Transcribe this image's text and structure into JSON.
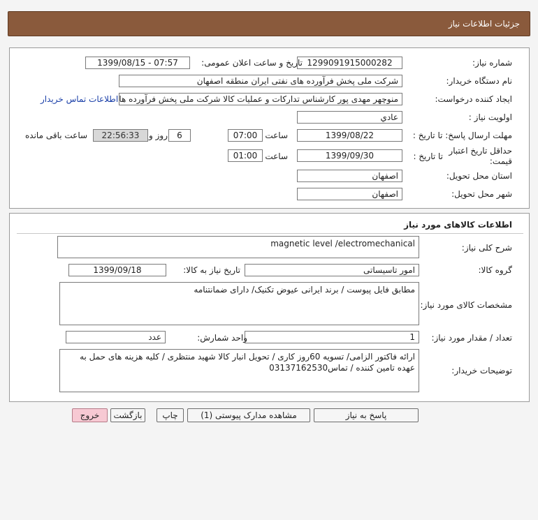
{
  "header": {
    "title": "جزئیات اطلاعات نیاز"
  },
  "info": {
    "need_number_label": "شماره نیاز:",
    "need_number": "1299091915000282",
    "announce_label": "تاریخ و ساعت اعلان عمومی:",
    "announce_value": "1399/08/15 - 07:57",
    "buyer_org_label": "نام دستگاه خریدار:",
    "buyer_org": "شرکت ملی پخش فرآورده های نفتی ایران منطقه اصفهان",
    "requester_label": "ایجاد کننده درخواست:",
    "requester": "منوچهر مهدی پور کارشناس تدارکات و عملیات کالا شرکت ملی پخش فرآورده های",
    "contact_link": "اطلاعات تماس خریدار",
    "priority_label": "اولویت نیاز :",
    "priority": "عادي",
    "deadline_label": "مهلت ارسال پاسخ: تا تاریخ :",
    "deadline_date": "1399/08/22",
    "time_label": "ساعت",
    "deadline_time": "07:00",
    "days": "6",
    "days_label": "روز و",
    "remaining_time": "22:56:33",
    "remaining_label": "ساعت باقی مانده",
    "validity_label_1": "حداقل تاریخ اعتبار",
    "validity_label_2": "قیمت:",
    "validity_to_label": "تا تاریخ :",
    "validity_date": "1399/09/30",
    "validity_time_label": "ساعت",
    "validity_time": "01:00",
    "province_label": "استان محل تحویل:",
    "province": "اصفهان",
    "city_label": "شهر محل تحویل:",
    "city": "اصفهان"
  },
  "goods": {
    "section_title": "اطلاعات کالاهای مورد نیاز",
    "general_desc_label": "شرح کلی نیاز:",
    "general_desc": "magnetic level /electromechanical",
    "group_label": "گروه کالا:",
    "group": "امور تاسیساتی",
    "need_date_label": "تاریخ نیاز به کالا:",
    "need_date": "1399/09/18",
    "specs_label": "مشخصات کالای مورد نیاز:",
    "specs": "مطابق فایل پیوست / برند ایرانی عیوض تکنیک/ دارای ضمانتنامه",
    "qty_label": "تعداد / مقدار مورد نیاز:",
    "qty": "1",
    "unit_label": "واحد شمارش:",
    "unit": "عدد",
    "buyer_notes_label": "توضیحات خریدار:",
    "buyer_notes": "ارائه  فاکتور الزامی/ تسویه 60روز کاری / تحویل انبار کالا شهید منتظری / کلیه هزینه های حمل به عهده تامین کننده / تماس03137162530"
  },
  "buttons": {
    "respond": "پاسخ به نیاز",
    "attachments": "مشاهده مدارک پیوستی (1)",
    "print": "چاپ",
    "back": "بازگشت",
    "exit": "خروج"
  }
}
